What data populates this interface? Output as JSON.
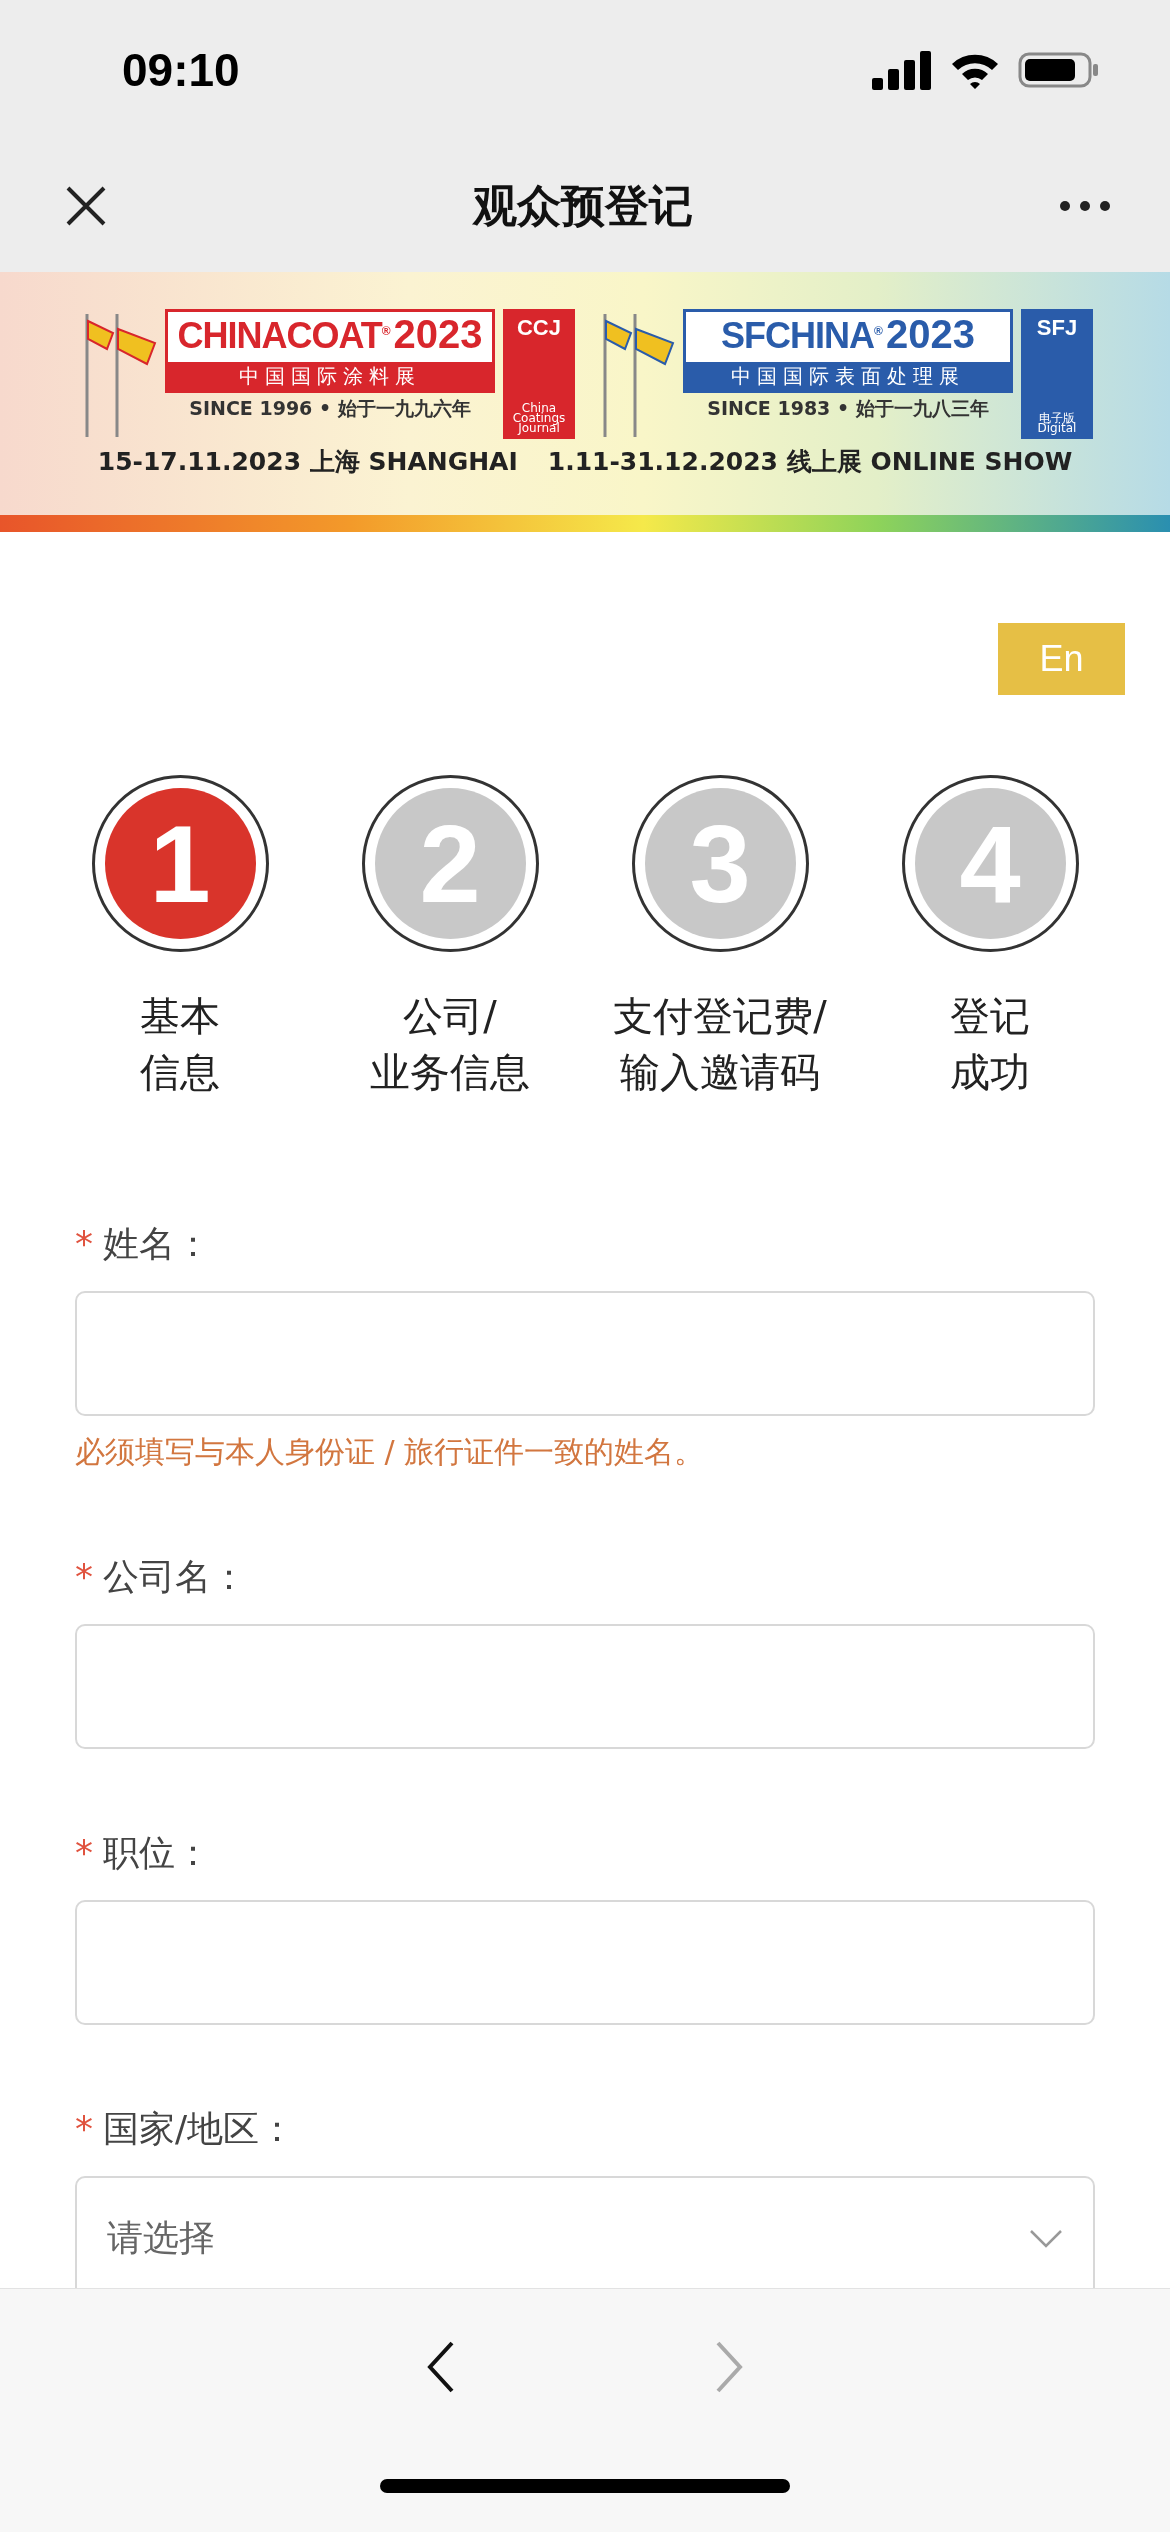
{
  "status_bar": {
    "time": "09:10"
  },
  "nav": {
    "title": "观众预登记"
  },
  "banner": {
    "events": [
      {
        "name": "CHINACOAT$^{®}$",
        "year": "2023",
        "subtitle": "中国国际涂料展",
        "since": "SINCE 1996 • 始于一九九六年",
        "journal": "CCJ",
        "journal_note": "China Coatings Journal",
        "color": "#d8262c"
      },
      {
        "name": "SFCHINA$^{®}$",
        "year": "2023",
        "subtitle": "中国国际表面处理展",
        "since": "SINCE 1983 • 始于一九八三年",
        "journal": "SFJ",
        "journal_note": "电子版 Digital",
        "color": "#2a5caa"
      }
    ],
    "dates": [
      "15-17.11.2023 上海 SHANGHAI",
      "1.11-31.12.2023 线上展 ONLINE SHOW"
    ]
  },
  "language_button": "En",
  "steps": [
    {
      "number": "1",
      "label": [
        "基本",
        "信息"
      ],
      "selected": true
    },
    {
      "number": "2",
      "label": [
        "公司/",
        "业务信息"
      ],
      "selected": false
    },
    {
      "number": "3",
      "label": [
        "支付登记费/",
        "输入邀请码"
      ],
      "selected": false
    },
    {
      "number": "4",
      "label": [
        "登记",
        "成功"
      ],
      "selected": false
    }
  ],
  "fields": [
    {
      "kind": "text",
      "required_mark": "*",
      "label": "姓名：",
      "hint": "必须填写与本人身份证 / 旅行证件一致的姓名。"
    },
    {
      "kind": "text",
      "required_mark": "*",
      "label": "公司名："
    },
    {
      "kind": "text",
      "required_mark": "*",
      "label": "职位："
    },
    {
      "kind": "select",
      "required_mark": "*",
      "label": "国家/地区：",
      "placeholder": "请选择"
    }
  ],
  "toolbar": {
    "back": {
      "disabled": false
    },
    "forward": {
      "disabled": true
    }
  }
}
